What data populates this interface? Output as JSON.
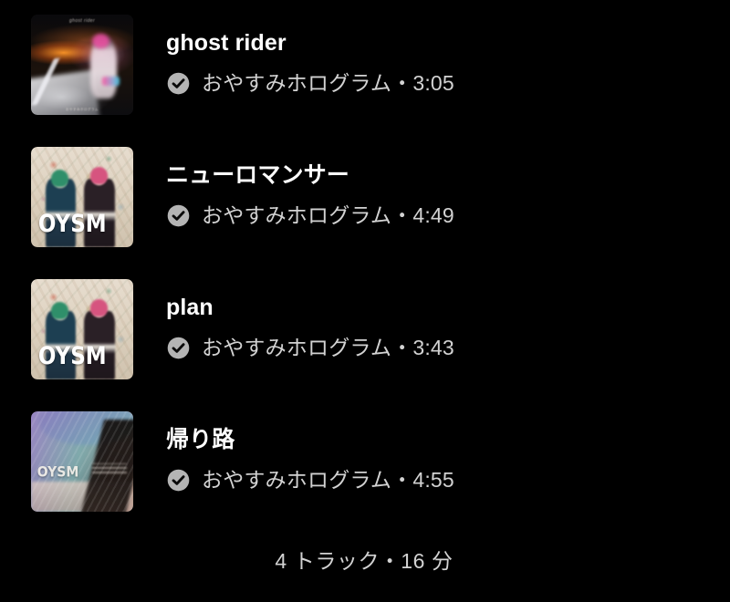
{
  "theme": {
    "background": "#000000",
    "title_color": "#ffffff",
    "secondary_text_color": "#d2d2d2",
    "badge_color": "#b4b4b4"
  },
  "track_list": {
    "tracks": [
      {
        "title": "ghost rider",
        "artist": "おやすみホログラム",
        "separator": "・",
        "duration": "3:05",
        "verified_icon": "verified-check-icon",
        "artwork_name": "album-art-ghost-rider",
        "artwork_caption_top": "ghost rider",
        "artwork_caption_bottom": "おやすみホログラム"
      },
      {
        "title": "ニューロマンサー",
        "artist": "おやすみホログラム",
        "separator": "・",
        "duration": "4:49",
        "verified_icon": "verified-check-icon",
        "artwork_name": "album-art-neuromancer",
        "artwork_logo": "OYSM"
      },
      {
        "title": "plan",
        "artist": "おやすみホログラム",
        "separator": "・",
        "duration": "3:43",
        "verified_icon": "verified-check-icon",
        "artwork_name": "album-art-plan",
        "artwork_logo": "OYSM"
      },
      {
        "title": "帰り路",
        "artist": "おやすみホログラム",
        "separator": "・",
        "duration": "4:55",
        "verified_icon": "verified-check-icon",
        "artwork_name": "album-art-kaerimichi",
        "artwork_logo": "OYSM"
      }
    ],
    "footer": "4 トラック・16 分"
  }
}
